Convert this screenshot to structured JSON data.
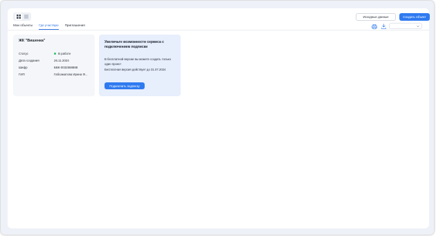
{
  "header": {
    "history_button": "Исходные данные",
    "create_button": "Создать объект"
  },
  "view_toggle": {
    "options": [
      "grid-icon",
      "list-icon"
    ],
    "active": "grid"
  },
  "tabs": [
    {
      "label": "Мои объекты",
      "active": false
    },
    {
      "label": "Где участвую",
      "active": true
    },
    {
      "label": "Приглашения",
      "active": false
    }
  ],
  "toolbar": {
    "print_icon": "print-icon",
    "download_icon": "download-icon",
    "select_value": ""
  },
  "object_card": {
    "title": "ЖК \"Вишенка\"",
    "fields": [
      {
        "label": "Статус",
        "value": "В работе",
        "status_color": "#2cc46b"
      },
      {
        "label": "Дата создания",
        "value": "26.11.2024"
      },
      {
        "label": "Шифр",
        "value": "БВК-0032588888"
      },
      {
        "label": "ГИП",
        "value": "Габсаматова Ирина Ф..."
      }
    ]
  },
  "promo": {
    "title": "Увеличьте возможности сервиса с подключением подписки",
    "text_1": "В бесплатной версии вы можете создать только один проект",
    "text_2": "Бесплатная версия действует до 31.07.2024",
    "button": "Подключить подписку"
  },
  "colors": {
    "accent": "#2f7af0",
    "background": "#eef1f7",
    "status_ok": "#2cc46b",
    "promo_bg": "#e7eefc"
  }
}
